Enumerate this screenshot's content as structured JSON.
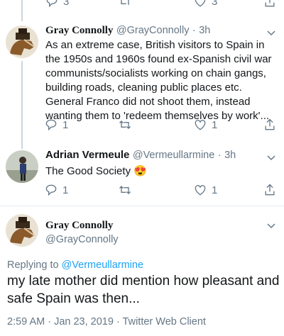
{
  "top_row": {
    "reply_count": "3",
    "like_count": "3"
  },
  "tweets": [
    {
      "name": "Gray Connolly",
      "handle": "@GrayConnolly",
      "time": "3h",
      "text": "As an extreme case, British visitors to Spain in the 1950s and 1960s found ex-Spanish civil war communists/socialists working on chain gangs, building roads, cleaning public places etc. General Franco did not shoot them, instead wanting them to 'redeem themselves by work'...",
      "reply_count": "1",
      "like_count": "1"
    },
    {
      "name": "Adrian Vermeule",
      "handle": "@Vermeullarmine",
      "time": "3h",
      "text": "The Good Society",
      "emoji": "😍",
      "reply_count": "1",
      "like_count": "1"
    }
  ],
  "main_tweet": {
    "name": "Gray Connolly",
    "handle": "@GrayConnolly",
    "replying_prefix": "Replying to",
    "replying_to": "@Vermeullarmine",
    "text": "my late mother did mention how pleasant and safe Spain was then...",
    "timestamp": "2:59 AM · Jan 23, 2019 · Twitter Web Client"
  },
  "colors": {
    "link": "#1da1f2",
    "muted": "#657786",
    "line": "#ccd6dd"
  }
}
